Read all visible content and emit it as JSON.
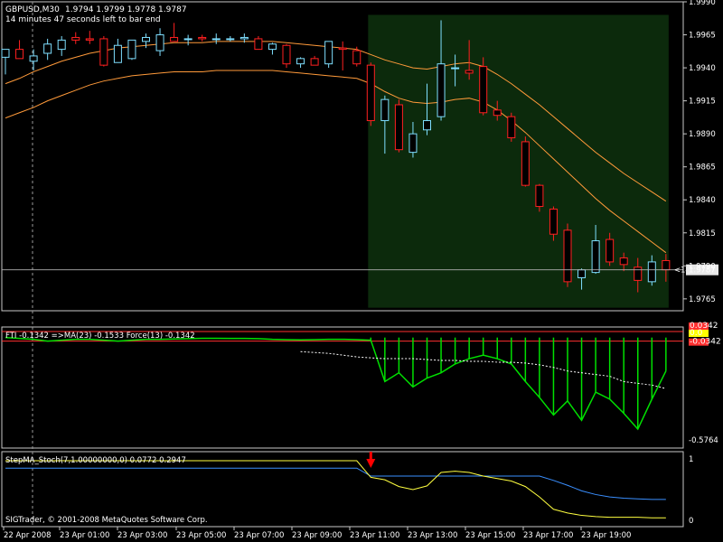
{
  "header": {
    "symbol": "GBPUSD,M30",
    "ohlc": "1.9794 1.9799 1.9778 1.9787",
    "countdown": "14 minutes 47 seconds left to bar end"
  },
  "footer": {
    "copyright": "SIGTrader, © 2001-2008 MetaQuotes Software Corp."
  },
  "colors": {
    "background": "#000000",
    "grid": "#c8c8c8",
    "bull_candle": "#7fdfff",
    "bear_candle": "#ff2020",
    "ma_band": "#ff9a3a",
    "highlight_zone": "#0c2a0c",
    "fti_line": "#00e000",
    "signal_line": "#ffff00",
    "level_red": "#ff3030",
    "stoch_blue": "#3a8fff",
    "stoch_yellow": "#ffff40",
    "arrow": "#ff0000"
  },
  "chart_data": [
    {
      "type": "candlestick",
      "title": "GBPUSD,M30",
      "ylim": [
        1.9756,
        1.999
      ],
      "y_ticks": [
        "1.9990",
        "1.9965",
        "1.9940",
        "1.9915",
        "1.9890",
        "1.9865",
        "1.9840",
        "1.9815",
        "1.9790",
        "1.9765"
      ],
      "x_ticks": [
        "22 Apr 2008",
        "23 Apr 01:00",
        "23 Apr 03:00",
        "23 Apr 05:00",
        "23 Apr 07:00",
        "23 Apr 09:00",
        "23 Apr 11:00",
        "23 Apr 13:00",
        "23 Apr 15:00",
        "23 Apr 17:00",
        "23 Apr 19:00"
      ],
      "current_price": "1.9787",
      "timer_label": "<14:47",
      "candles": [
        {
          "o": 1.9948,
          "h": 1.9954,
          "l": 1.9935,
          "c": 1.9954
        },
        {
          "o": 1.9954,
          "h": 1.9961,
          "l": 1.9949,
          "c": 1.9947
        },
        {
          "o": 1.9945,
          "h": 1.9954,
          "l": 1.9938,
          "c": 1.9949
        },
        {
          "o": 1.9951,
          "h": 1.9962,
          "l": 1.9946,
          "c": 1.9958
        },
        {
          "o": 1.9954,
          "h": 1.9964,
          "l": 1.9949,
          "c": 1.9961
        },
        {
          "o": 1.9963,
          "h": 1.9967,
          "l": 1.9958,
          "c": 1.9961
        },
        {
          "o": 1.9962,
          "h": 1.9968,
          "l": 1.9958,
          "c": 1.9961
        },
        {
          "o": 1.9962,
          "h": 1.9964,
          "l": 1.9941,
          "c": 1.9942
        },
        {
          "o": 1.9944,
          "h": 1.9962,
          "l": 1.9944,
          "c": 1.9957
        },
        {
          "o": 1.9947,
          "h": 1.9961,
          "l": 1.9946,
          "c": 1.9961
        },
        {
          "o": 1.996,
          "h": 1.9966,
          "l": 1.9955,
          "c": 1.9963
        },
        {
          "o": 1.9953,
          "h": 1.997,
          "l": 1.9949,
          "c": 1.9965
        },
        {
          "o": 1.9963,
          "h": 1.9974,
          "l": 1.9962,
          "c": 1.996
        },
        {
          "o": 1.9962,
          "h": 1.9965,
          "l": 1.9957,
          "c": 1.9962
        },
        {
          "o": 1.9963,
          "h": 1.9965,
          "l": 1.996,
          "c": 1.9962
        },
        {
          "o": 1.9962,
          "h": 1.9966,
          "l": 1.9958,
          "c": 1.9962
        },
        {
          "o": 1.9962,
          "h": 1.9964,
          "l": 1.996,
          "c": 1.9962
        },
        {
          "o": 1.9962,
          "h": 1.9966,
          "l": 1.9959,
          "c": 1.9963
        },
        {
          "o": 1.9962,
          "h": 1.9964,
          "l": 1.9957,
          "c": 1.9954
        },
        {
          "o": 1.9954,
          "h": 1.9959,
          "l": 1.995,
          "c": 1.9958
        },
        {
          "o": 1.9957,
          "h": 1.9958,
          "l": 1.994,
          "c": 1.9943
        },
        {
          "o": 1.9943,
          "h": 1.9948,
          "l": 1.994,
          "c": 1.9947
        },
        {
          "o": 1.9947,
          "h": 1.9949,
          "l": 1.9942,
          "c": 1.9942
        },
        {
          "o": 1.9943,
          "h": 1.9958,
          "l": 1.994,
          "c": 1.996
        },
        {
          "o": 1.9955,
          "h": 1.996,
          "l": 1.9938,
          "c": 1.9954
        },
        {
          "o": 1.9953,
          "h": 1.9956,
          "l": 1.9941,
          "c": 1.9943
        },
        {
          "o": 1.9942,
          "h": 1.9944,
          "l": 1.9896,
          "c": 1.99
        },
        {
          "o": 1.99,
          "h": 1.9919,
          "l": 1.9875,
          "c": 1.9916
        },
        {
          "o": 1.9912,
          "h": 1.9916,
          "l": 1.9876,
          "c": 1.9878
        },
        {
          "o": 1.9876,
          "h": 1.9899,
          "l": 1.9872,
          "c": 1.989
        },
        {
          "o": 1.9893,
          "h": 1.9928,
          "l": 1.9889,
          "c": 1.99
        },
        {
          "o": 1.9903,
          "h": 1.9976,
          "l": 1.99,
          "c": 1.9943
        },
        {
          "o": 1.994,
          "h": 1.995,
          "l": 1.9926,
          "c": 1.994
        },
        {
          "o": 1.9938,
          "h": 1.9961,
          "l": 1.9931,
          "c": 1.9936
        },
        {
          "o": 1.9941,
          "h": 1.9948,
          "l": 1.9904,
          "c": 1.9906
        },
        {
          "o": 1.9908,
          "h": 1.9915,
          "l": 1.99,
          "c": 1.9904
        },
        {
          "o": 1.9903,
          "h": 1.9906,
          "l": 1.9884,
          "c": 1.9887
        },
        {
          "o": 1.9884,
          "h": 1.9888,
          "l": 1.985,
          "c": 1.9851
        },
        {
          "o": 1.9851,
          "h": 1.9852,
          "l": 1.9831,
          "c": 1.9835
        },
        {
          "o": 1.9833,
          "h": 1.9835,
          "l": 1.9809,
          "c": 1.9814
        },
        {
          "o": 1.9817,
          "h": 1.9822,
          "l": 1.9774,
          "c": 1.9778
        },
        {
          "o": 1.9781,
          "h": 1.9788,
          "l": 1.9772,
          "c": 1.9787
        },
        {
          "o": 1.9785,
          "h": 1.9821,
          "l": 1.9784,
          "c": 1.9809
        },
        {
          "o": 1.981,
          "h": 1.9815,
          "l": 1.979,
          "c": 1.9793
        },
        {
          "o": 1.9796,
          "h": 1.98,
          "l": 1.9786,
          "c": 1.9791
        },
        {
          "o": 1.9789,
          "h": 1.9796,
          "l": 1.977,
          "c": 1.9779
        },
        {
          "o": 1.9778,
          "h": 1.9798,
          "l": 1.9775,
          "c": 1.9793
        },
        {
          "o": 1.9794,
          "h": 1.9799,
          "l": 1.9778,
          "c": 1.9787
        }
      ],
      "ma_upper": [
        1.9928,
        1.9932,
        1.9937,
        1.9941,
        1.9945,
        1.9948,
        1.9951,
        1.9953,
        1.9955,
        1.9956,
        1.9957,
        1.9958,
        1.9959,
        1.9959,
        1.9959,
        1.996,
        1.996,
        1.996,
        1.996,
        1.996,
        1.9959,
        1.9958,
        1.9957,
        1.9956,
        1.9955,
        1.9954,
        1.995,
        1.9946,
        1.9943,
        1.994,
        1.9939,
        1.9941,
        1.9943,
        1.9944,
        1.9941,
        1.9935,
        1.9928,
        1.992,
        1.9912,
        1.9903,
        1.9894,
        1.9885,
        1.9876,
        1.9868,
        1.986,
        1.9853,
        1.9846,
        1.9839
      ],
      "ma_lower": [
        1.9902,
        1.9906,
        1.991,
        1.9915,
        1.9919,
        1.9923,
        1.9927,
        1.993,
        1.9932,
        1.9934,
        1.9935,
        1.9936,
        1.9937,
        1.9937,
        1.9937,
        1.9938,
        1.9938,
        1.9938,
        1.9938,
        1.9938,
        1.9937,
        1.9936,
        1.9935,
        1.9934,
        1.9933,
        1.9932,
        1.9928,
        1.9922,
        1.9917,
        1.9914,
        1.9913,
        1.9914,
        1.9916,
        1.9917,
        1.9914,
        1.9908,
        1.99,
        1.9891,
        1.9881,
        1.9871,
        1.9861,
        1.9851,
        1.9841,
        1.9832,
        1.9824,
        1.9816,
        1.9808,
        1.98
      ],
      "highlight_zone": {
        "from_bar": 26,
        "to_bar": 47,
        "top": 1.9976,
        "bottom": 1.9772
      }
    },
    {
      "type": "line",
      "title": "FTI -0.1342  =>MA(23) -0.1533  Force(13) -0.1342",
      "ylim": [
        -0.5764,
        0.0342
      ],
      "y_ticks": [
        "-0.5764"
      ],
      "level_labels": [
        "0.0342",
        "0.0",
        "-0.0342"
      ],
      "fti": [
        0,
        -0.005,
        -0.01,
        -0.02,
        -0.015,
        -0.01,
        -0.01,
        -0.015,
        -0.02,
        -0.015,
        -0.01,
        -0.01,
        -0.008,
        -0.006,
        -0.004,
        -0.004,
        -0.005,
        -0.005,
        -0.006,
        -0.01,
        -0.012,
        -0.013,
        -0.012,
        -0.01,
        -0.01,
        -0.012,
        -0.015,
        -0.25,
        -0.2,
        -0.28,
        -0.23,
        -0.2,
        -0.15,
        -0.12,
        -0.1,
        -0.12,
        -0.15,
        -0.25,
        -0.34,
        -0.44,
        -0.36,
        -0.47,
        -0.31,
        -0.35,
        -0.43,
        -0.52,
        -0.35,
        -0.19
      ],
      "ma": [
        null,
        null,
        null,
        null,
        null,
        null,
        null,
        null,
        null,
        null,
        null,
        null,
        null,
        null,
        null,
        null,
        null,
        null,
        null,
        null,
        null,
        -0.08,
        -0.085,
        -0.09,
        -0.1,
        -0.11,
        -0.115,
        -0.12,
        -0.12,
        -0.12,
        -0.125,
        -0.13,
        -0.13,
        -0.135,
        -0.135,
        -0.14,
        -0.14,
        -0.145,
        -0.155,
        -0.17,
        -0.19,
        -0.2,
        -0.21,
        -0.22,
        -0.25,
        -0.26,
        -0.27,
        -0.29
      ]
    },
    {
      "type": "line",
      "title": "StepMA_Stoch(7,1.00000000,0) 0.0772 0.2947",
      "ylim": [
        0,
        1
      ],
      "y_ticks": [
        "1",
        "0"
      ],
      "signal_arrow_bar": 26,
      "blue": [
        0.85,
        0.85,
        0.85,
        0.85,
        0.85,
        0.85,
        0.85,
        0.85,
        0.85,
        0.85,
        0.85,
        0.85,
        0.85,
        0.85,
        0.85,
        0.85,
        0.85,
        0.85,
        0.85,
        0.85,
        0.85,
        0.85,
        0.85,
        0.85,
        0.85,
        0.85,
        0.72,
        0.72,
        0.72,
        0.72,
        0.72,
        0.72,
        0.72,
        0.72,
        0.72,
        0.72,
        0.72,
        0.72,
        0.72,
        0.65,
        0.57,
        0.48,
        0.42,
        0.38,
        0.36,
        0.35,
        0.34,
        0.34
      ],
      "yellow": [
        0.97,
        0.97,
        0.97,
        0.97,
        0.97,
        0.97,
        0.97,
        0.97,
        0.97,
        0.97,
        0.97,
        0.97,
        0.97,
        0.97,
        0.97,
        0.97,
        0.97,
        0.97,
        0.97,
        0.97,
        0.97,
        0.97,
        0.97,
        0.97,
        0.97,
        0.97,
        0.7,
        0.66,
        0.55,
        0.5,
        0.56,
        0.78,
        0.8,
        0.78,
        0.72,
        0.68,
        0.64,
        0.55,
        0.38,
        0.18,
        0.12,
        0.08,
        0.06,
        0.05,
        0.05,
        0.05,
        0.04,
        0.04
      ]
    }
  ]
}
